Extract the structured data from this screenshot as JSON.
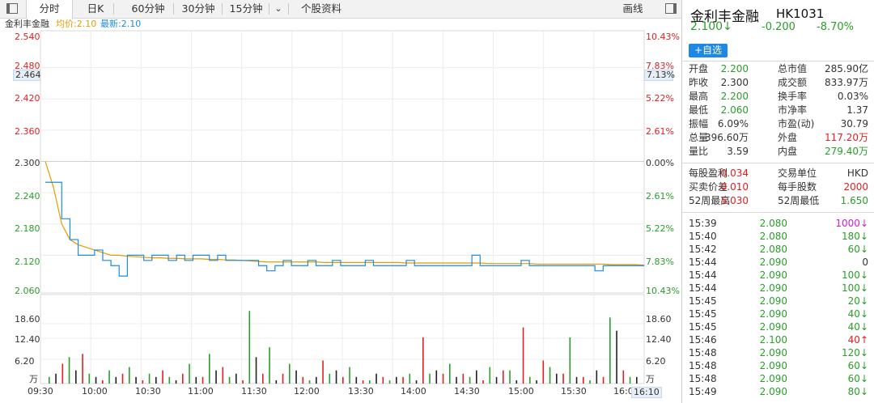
{
  "toolbar": {
    "tabs": [
      "分时",
      "日K",
      "60分钟",
      "30分钟",
      "15分钟",
      "个股资料"
    ],
    "active_tab": "分时",
    "chart_type_label": "画线"
  },
  "legend": {
    "name": "金利丰金融",
    "avg_label": "均价:2.10",
    "last_label": "最新:2.10"
  },
  "colors": {
    "up": "#e02020",
    "down": "#2a9d2a",
    "price_line": "#1e8bdc",
    "avg_line": "#e69a00"
  },
  "chart_data": {
    "type": "line",
    "title": "",
    "price_axis": [
      "2.540",
      "2.480",
      "2.420",
      "2.360",
      "2.300",
      "2.240",
      "2.180",
      "2.120",
      "2.060"
    ],
    "pct_axis": [
      "10.43%",
      "7.83%",
      "5.22%",
      "2.61%",
      "0.00%",
      "2.61%",
      "5.22%",
      "7.83%",
      "10.43%"
    ],
    "cursor_price": "2.464",
    "cursor_pct": "7.13%",
    "ylim": [
      2.06,
      2.54
    ],
    "prev_close": 2.3,
    "volume_axis": [
      "18.60",
      "12.40",
      "6.20",
      "万"
    ],
    "volume_ylim": [
      0,
      25
    ],
    "x_labels": [
      "09:30",
      "10:00",
      "10:30",
      "11:00",
      "11:30",
      "12:00",
      "13:30",
      "14:00",
      "14:30",
      "15:00",
      "15:30",
      "16:0",
      "16:10"
    ],
    "price": [
      2.26,
      2.26,
      2.19,
      2.15,
      2.12,
      2.12,
      2.13,
      2.11,
      2.1,
      2.08,
      2.12,
      2.12,
      2.11,
      2.12,
      2.12,
      2.11,
      2.12,
      2.11,
      2.12,
      2.12,
      2.11,
      2.12,
      2.11,
      2.11,
      2.11,
      2.11,
      2.1,
      2.09,
      2.1,
      2.11,
      2.1,
      2.1,
      2.11,
      2.1,
      2.1,
      2.11,
      2.1,
      2.1,
      2.1,
      2.11,
      2.1,
      2.1,
      2.1,
      2.1,
      2.11,
      2.1,
      2.1,
      2.1,
      2.1,
      2.1,
      2.1,
      2.1,
      2.12,
      2.1,
      2.1,
      2.1,
      2.1,
      2.1,
      2.11,
      2.1,
      2.1,
      2.1,
      2.1,
      2.1,
      2.1,
      2.1,
      2.1,
      2.09,
      2.1,
      2.1,
      2.1,
      2.1,
      2.1,
      2.1
    ],
    "avg": [
      2.3,
      2.25,
      2.18,
      2.15,
      2.14,
      2.135,
      2.13,
      2.125,
      2.12,
      2.12,
      2.118,
      2.117,
      2.116,
      2.115,
      2.115,
      2.114,
      2.114,
      2.113,
      2.113,
      2.113,
      2.112,
      2.112,
      2.111,
      2.111,
      2.11,
      2.109,
      2.108,
      2.107,
      2.107,
      2.107,
      2.107,
      2.107,
      2.107,
      2.107,
      2.106,
      2.106,
      2.106,
      2.106,
      2.106,
      2.106,
      2.106,
      2.106,
      2.106,
      2.106,
      2.105,
      2.105,
      2.105,
      2.105,
      2.105,
      2.105,
      2.105,
      2.105,
      2.105,
      2.105,
      2.104,
      2.104,
      2.104,
      2.104,
      2.104,
      2.104,
      2.103,
      2.103,
      2.103,
      2.103,
      2.103,
      2.103,
      2.103,
      2.103,
      2.103,
      2.102,
      2.102,
      2.102,
      2.102,
      2.101
    ],
    "volume": [
      2,
      3,
      6,
      8,
      4,
      9,
      3,
      2,
      1,
      4,
      2,
      3,
      5,
      2,
      1,
      3,
      2,
      4,
      2,
      1,
      3,
      6,
      2,
      2,
      9,
      4,
      5,
      2,
      3,
      1,
      22,
      8,
      3,
      11,
      1,
      3,
      6,
      4,
      2,
      1,
      2,
      7,
      3,
      4,
      2,
      5,
      2,
      1,
      1,
      3,
      2,
      1,
      2,
      2,
      3,
      1,
      14,
      3,
      4,
      3,
      6,
      2,
      3,
      2,
      4,
      1,
      5,
      2,
      4,
      4,
      1,
      17,
      2,
      1,
      7,
      5,
      3,
      3,
      14,
      2,
      2,
      1,
      4,
      2,
      20,
      16,
      4,
      2,
      2
    ]
  },
  "quote": {
    "name": "金利丰金融",
    "code": "HK1031",
    "price": "2.100↓",
    "change": "-0.200",
    "change_pct": "-8.70%",
    "add_button": "+自选",
    "stats": [
      [
        "开盘",
        "2.200",
        "green",
        "总市值",
        "285.90亿",
        ""
      ],
      [
        "昨收",
        "2.300",
        "",
        "成交额",
        "833.97万",
        ""
      ],
      [
        "最高",
        "2.200",
        "green",
        "换手率",
        "0.03%",
        ""
      ],
      [
        "最低",
        "2.060",
        "green",
        "市净率",
        "1.37",
        ""
      ],
      [
        "振幅",
        "6.09%",
        "",
        "市盈(动)",
        "30.79",
        ""
      ],
      [
        "总量",
        "396.60万",
        "",
        "外盘",
        "117.20万",
        "red"
      ],
      [
        "量比",
        "3.59",
        "",
        "内盘",
        "279.40万",
        "green"
      ]
    ],
    "stats2": [
      [
        "每股盈利",
        "0.034",
        "red",
        "交易单位",
        "HKD",
        ""
      ],
      [
        "买卖价差",
        "0.010",
        "red",
        "每手股数",
        "2000",
        "red"
      ],
      [
        "52周最高",
        "5.030",
        "red",
        "52周最低",
        "1.650",
        "green"
      ]
    ],
    "trades": [
      [
        "15:39",
        "2.080",
        "1000↓",
        "magenta"
      ],
      [
        "15:40",
        "2.080",
        "180↓",
        "green"
      ],
      [
        "15:42",
        "2.080",
        "60↓",
        "green"
      ],
      [
        "15:44",
        "2.090",
        "0",
        ""
      ],
      [
        "15:44",
        "2.090",
        "100↓",
        "green"
      ],
      [
        "15:44",
        "2.090",
        "100↓",
        "green"
      ],
      [
        "15:45",
        "2.090",
        "20↓",
        "green"
      ],
      [
        "15:45",
        "2.090",
        "40↓",
        "green"
      ],
      [
        "15:45",
        "2.090",
        "40↓",
        "green"
      ],
      [
        "15:46",
        "2.100",
        "40↑",
        "red"
      ],
      [
        "15:48",
        "2.090",
        "120↓",
        "green"
      ],
      [
        "15:48",
        "2.090",
        "60↓",
        "green"
      ],
      [
        "15:48",
        "2.090",
        "60↓",
        "green"
      ],
      [
        "15:49",
        "2.090",
        "80↓",
        "green"
      ]
    ]
  }
}
